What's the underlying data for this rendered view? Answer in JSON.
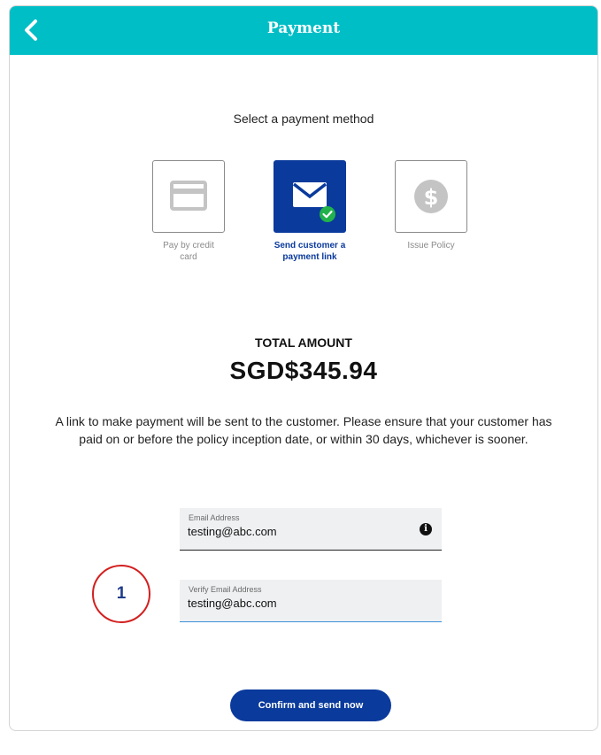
{
  "header": {
    "title": "Payment",
    "back_icon": "chevron-left-icon"
  },
  "subtitle": "Select a payment method",
  "methods": [
    {
      "label": "Pay by credit\ncard",
      "icon": "credit-card-icon",
      "selected": false
    },
    {
      "label": "Send customer a\npayment link",
      "icon": "envelope-icon",
      "selected": true
    },
    {
      "label": "Issue Policy",
      "icon": "dollar-coin-icon",
      "selected": false
    }
  ],
  "total": {
    "label": "TOTAL AMOUNT",
    "value": "SGD$345.94"
  },
  "notice": "A link to make payment will be sent to the customer. Please ensure that your customer has paid on or before the policy inception date, or within 30 days, whichever is sooner.",
  "email": {
    "label": "Email Address",
    "value": "testing@abc.com",
    "icon": "info-icon"
  },
  "verify_email": {
    "label": "Verify Email Address",
    "value": "testing@abc.com"
  },
  "annotation_marker": "1",
  "confirm_button": "Confirm and send now",
  "colors": {
    "header": "#00bec6",
    "primary": "#0a3a9c",
    "success": "#22b24c",
    "marker_border": "#d32020"
  }
}
